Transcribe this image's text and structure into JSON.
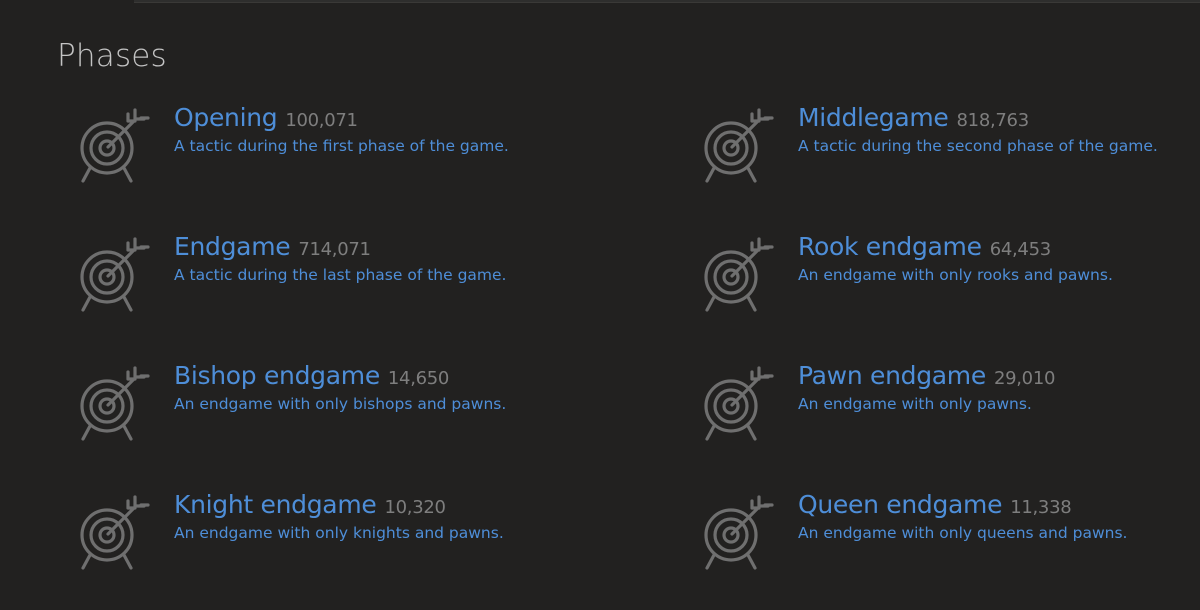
{
  "section": {
    "title": "Phases"
  },
  "themes": [
    {
      "name": "Opening",
      "count": "100,071",
      "description": "A tactic during the first phase of the game.",
      "icon": "target-arrow-icon"
    },
    {
      "name": "Middlegame",
      "count": "818,763",
      "description": "A tactic during the second phase of the game.",
      "icon": "target-arrow-icon"
    },
    {
      "name": "Endgame",
      "count": "714,071",
      "description": "A tactic during the last phase of the game.",
      "icon": "target-arrow-icon"
    },
    {
      "name": "Rook endgame",
      "count": "64,453",
      "description": "An endgame with only rooks and pawns.",
      "icon": "target-arrow-icon"
    },
    {
      "name": "Bishop endgame",
      "count": "14,650",
      "description": "An endgame with only bishops and pawns.",
      "icon": "target-arrow-icon"
    },
    {
      "name": "Pawn endgame",
      "count": "29,010",
      "description": "An endgame with only pawns.",
      "icon": "target-arrow-icon"
    },
    {
      "name": "Knight endgame",
      "count": "10,320",
      "description": "An endgame with only knights and pawns.",
      "icon": "target-arrow-icon"
    },
    {
      "name": "Queen endgame",
      "count": "11,338",
      "description": "An endgame with only queens and pawns.",
      "icon": "target-arrow-icon"
    }
  ],
  "colors": {
    "background": "#222120",
    "link": "#4e8ed8",
    "count": "#7e7e7e",
    "title": "#c4c4c4",
    "icon": "#6f6f6f"
  }
}
